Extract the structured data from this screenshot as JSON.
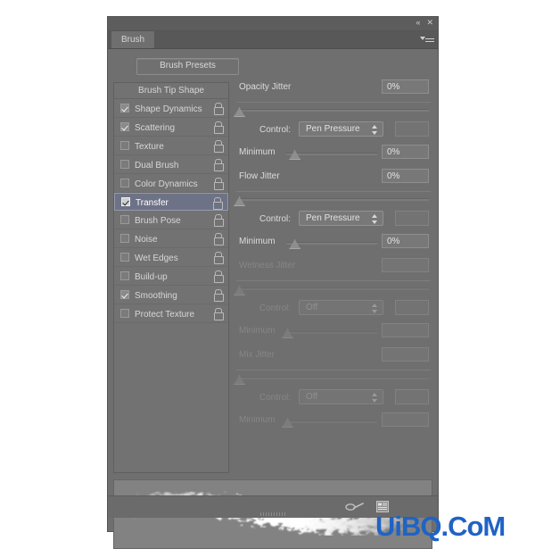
{
  "panel": {
    "title_tab": "Brush",
    "collapse_icon": "«",
    "close_icon": "✕",
    "menu_icon": "panel-menu-icon",
    "presets_button": "Brush Presets"
  },
  "option_list": {
    "header": "Brush Tip Shape",
    "items": [
      {
        "label": "Shape Dynamics",
        "checked": true,
        "selected": false,
        "lock": "unlocked"
      },
      {
        "label": "Scattering",
        "checked": true,
        "selected": false,
        "lock": "unlocked"
      },
      {
        "label": "Texture",
        "checked": false,
        "selected": false,
        "lock": "unlocked"
      },
      {
        "label": "Dual Brush",
        "checked": false,
        "selected": false,
        "lock": "unlocked"
      },
      {
        "label": "Color Dynamics",
        "checked": false,
        "selected": false,
        "lock": "unlocked"
      },
      {
        "label": "Transfer",
        "checked": true,
        "selected": true,
        "lock": "unlocked"
      },
      {
        "label": "Brush Pose",
        "checked": false,
        "selected": false,
        "lock": "unlocked"
      },
      {
        "label": "Noise",
        "checked": false,
        "selected": false,
        "lock": "unlocked"
      },
      {
        "label": "Wet Edges",
        "checked": false,
        "selected": false,
        "lock": "unlocked"
      },
      {
        "label": "Build-up",
        "checked": false,
        "selected": false,
        "lock": "unlocked"
      },
      {
        "label": "Smoothing",
        "checked": true,
        "selected": false,
        "lock": "unlocked"
      },
      {
        "label": "Protect Texture",
        "checked": false,
        "selected": false,
        "lock": "unlocked"
      }
    ]
  },
  "controls": {
    "control_label": "Control:",
    "minimum_label": "Minimum",
    "groups": [
      {
        "title": "Opacity Jitter",
        "value": "0%",
        "slider_percent": 0,
        "control": "Pen Pressure",
        "minimum_value": "0%",
        "minimum_percent": 8,
        "enabled": true
      },
      {
        "title": "Flow Jitter",
        "value": "0%",
        "slider_percent": 0,
        "control": "Pen Pressure",
        "minimum_value": "0%",
        "minimum_percent": 8,
        "enabled": true
      },
      {
        "title": "Wetness Jitter",
        "value": "",
        "slider_percent": 0,
        "control": "Off",
        "minimum_value": "",
        "minimum_percent": 0,
        "enabled": false
      },
      {
        "title": "Mix Jitter",
        "value": "",
        "slider_percent": 0,
        "control": "Off",
        "minimum_value": "",
        "minimum_percent": 0,
        "enabled": false
      }
    ]
  },
  "preview": {
    "name": "brush-stroke-preview"
  },
  "footer": {
    "toggle_brush_icon": "brush-stroke-toggle-icon",
    "new_brush_icon": "new-brush-preset-icon",
    "grip": "resize-grip"
  },
  "watermark": {
    "text": "UiBQ.CoM",
    "color": "#1f63c4"
  }
}
